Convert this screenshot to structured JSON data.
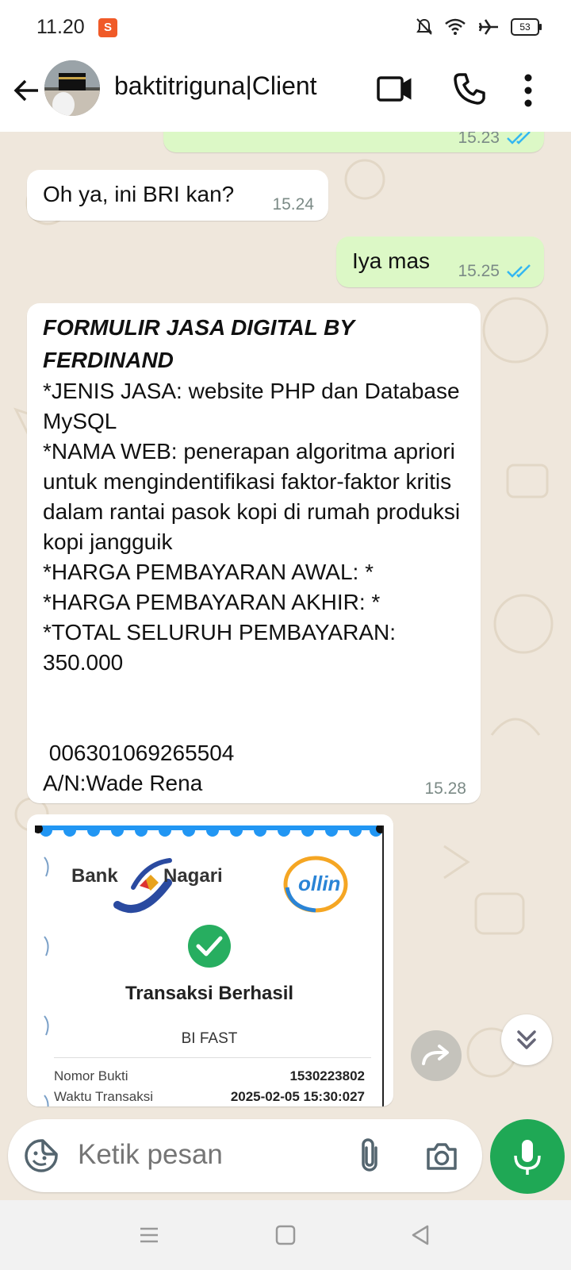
{
  "status_bar": {
    "time": "11.20",
    "battery": "53"
  },
  "header": {
    "contact_name": "baktitriguna|Client"
  },
  "messages": [
    {
      "dir": "out",
      "text": "",
      "time": "15.23"
    },
    {
      "dir": "in",
      "text": "Oh ya, ini BRI kan?",
      "time": "15.24"
    },
    {
      "dir": "out",
      "text": "Iya mas",
      "time": "15.25"
    },
    {
      "dir": "in",
      "title": "FORMULIR JASA DIGITAL BY FERDINAND",
      "body": "*JENIS JASA: website PHP dan Database MySQL\n*NAMA WEB: penerapan algoritma apriori untuk mengindentifikasi faktor-faktor kritis dalam rantai pasok kopi di rumah produksi kopi jangguik\n*HARGA PEMBAYARAN AWAL: *\n*HARGA PEMBAYARAN AKHIR: *\n*TOTAL SELURUH PEMBAYARAN: 350.000\n\n\n 006301069265504\nA/N:Wade Rena",
      "time": "15.28"
    }
  ],
  "receipt": {
    "bank_left": "Bank",
    "bank_right": "Nagari",
    "app_logo": "ollin",
    "status": "Transaksi Berhasil",
    "method": "BI FAST",
    "rows": [
      {
        "label": "Nomor Bukti",
        "value": "1530223802"
      },
      {
        "label": "Waktu Transaksi",
        "value": "2025-02-05 15:30:027"
      }
    ]
  },
  "input": {
    "placeholder": "Ketik pesan"
  },
  "icons": {
    "back": "arrow-left-icon",
    "video": "video-camera-icon",
    "call": "phone-icon",
    "menu": "more-vertical-icon",
    "sticker": "sticker-icon",
    "attach": "paperclip-icon",
    "camera": "camera-icon",
    "mic": "microphone-icon",
    "forward": "forward-icon",
    "scroll": "double-chevron-down-icon"
  },
  "colors": {
    "outgoing": "#dcf8c6",
    "incoming": "#ffffff",
    "accent": "#1fa855",
    "tick": "#34b7f1"
  }
}
